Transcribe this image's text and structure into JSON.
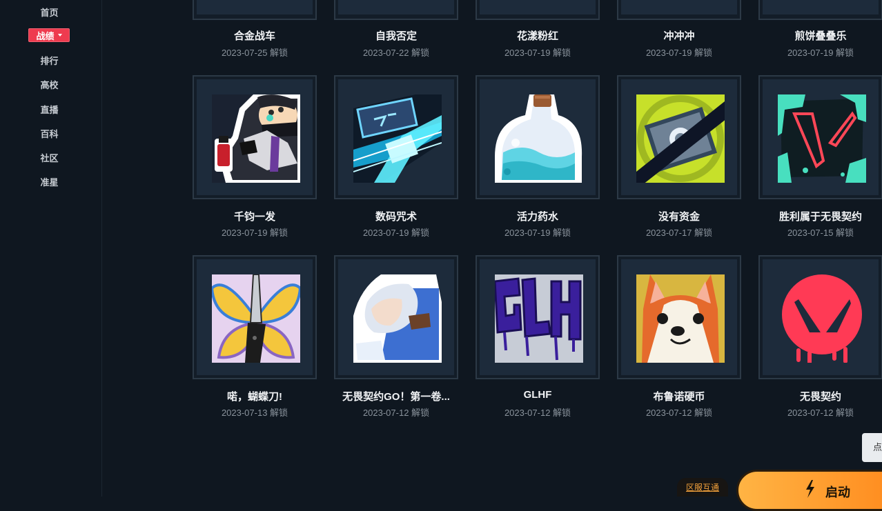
{
  "sidebar": {
    "items": [
      {
        "label": "首页"
      },
      {
        "label": "战绩"
      },
      {
        "label": "排行"
      },
      {
        "label": "高校"
      },
      {
        "label": "直播"
      },
      {
        "label": "百科"
      },
      {
        "label": "社区"
      },
      {
        "label": "准星"
      }
    ]
  },
  "sprays": {
    "row1": [
      {
        "name": "合金战车",
        "date": "2023-07-25 解锁"
      },
      {
        "name": "自我否定",
        "date": "2023-07-22 解锁"
      },
      {
        "name": "花漾粉红",
        "date": "2023-07-19 解锁"
      },
      {
        "name": "冲冲冲",
        "date": "2023-07-19 解锁"
      },
      {
        "name": "煎饼叠叠乐",
        "date": "2023-07-19 解锁"
      }
    ],
    "row2": [
      {
        "name": "千钧一发",
        "date": "2023-07-19 解锁",
        "icon": "ninja-spray-icon"
      },
      {
        "name": "数码咒术",
        "date": "2023-07-19 解锁",
        "icon": "circuit-chip-spray-icon"
      },
      {
        "name": "活力药水",
        "date": "2023-07-19 解锁",
        "icon": "potion-bottle-spray-icon"
      },
      {
        "name": "没有资金",
        "date": "2023-07-17 解锁",
        "icon": "no-credits-spray-icon"
      },
      {
        "name": "胜利属于无畏契约",
        "date": "2023-07-15 解锁",
        "icon": "valorant-splatter-spray-icon"
      }
    ],
    "row3": [
      {
        "name": "喏，蝴蝶刀!",
        "date": "2023-07-13 解锁",
        "icon": "butterfly-knife-spray-icon"
      },
      {
        "name": "无畏契约GO！第一卷...",
        "date": "2023-07-12 解锁",
        "icon": "anime-agent-spray-icon"
      },
      {
        "name": "GLHF",
        "date": "2023-07-12 解锁",
        "icon": "glhf-graffiti-spray-icon"
      },
      {
        "name": "布鲁诺硬币",
        "date": "2023-07-12 解锁",
        "icon": "corgi-coin-spray-icon"
      },
      {
        "name": "无畏契约",
        "date": "2023-07-12 解锁",
        "icon": "valorant-logo-spray-icon"
      }
    ]
  },
  "footer": {
    "region_label": "区服互通",
    "launch_label": "启动",
    "side_tab_label": "点"
  },
  "colors": {
    "accent_red": "#ee3b4f",
    "launch_orange": "#ff9f30",
    "background": "#0f1720"
  }
}
